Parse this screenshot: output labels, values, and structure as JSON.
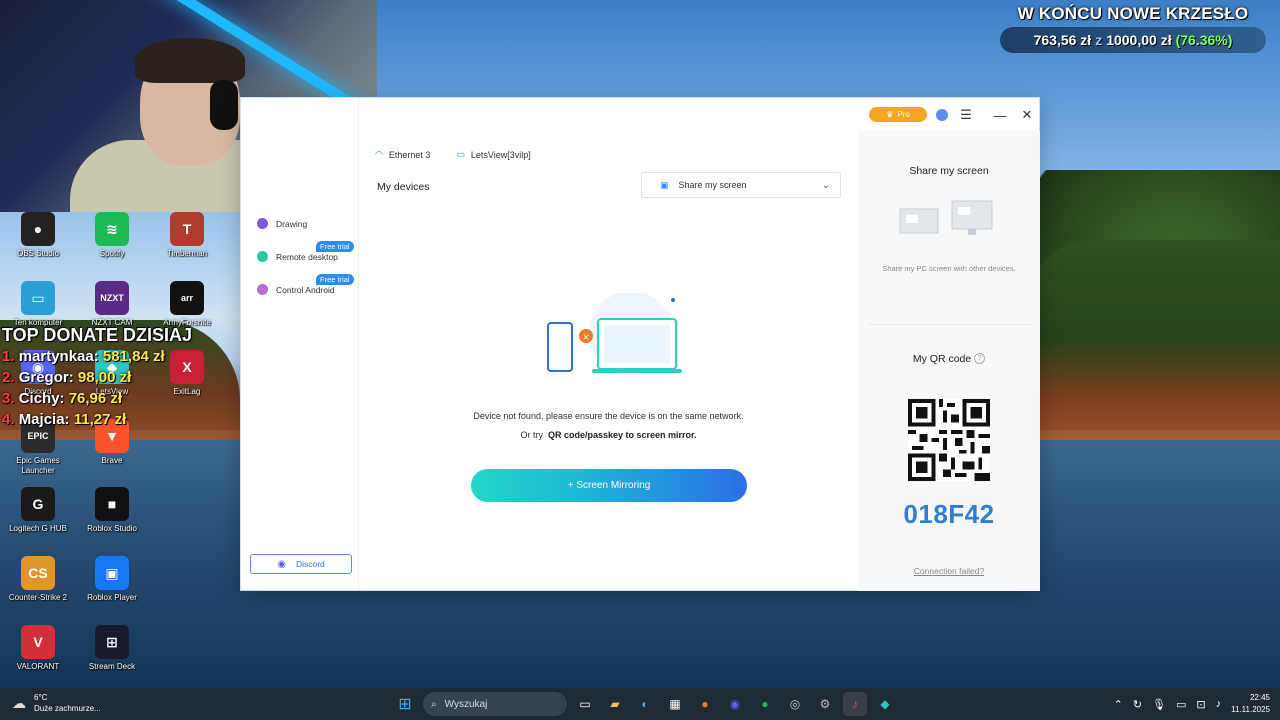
{
  "stream_overlay": {
    "goal_title": "W KOŃCU NOWE KRZESŁO",
    "goal_current": "763,56 zł",
    "goal_sep": "z",
    "goal_target": "1000,00 zł",
    "goal_percent": "(76.36%)",
    "top_donate_title": "TOP DONATE DZISIAJ",
    "top_donate": [
      {
        "rank": "1.",
        "name": "martynkaa:",
        "amount": "581,84 zł"
      },
      {
        "rank": "2.",
        "name": "Gregor:",
        "amount": "98,00 zł"
      },
      {
        "rank": "3.",
        "name": "Cichy:",
        "amount": "76,96 zł"
      },
      {
        "rank": "4.",
        "name": "Majcia:",
        "amount": "11,27 zł"
      }
    ]
  },
  "desktop_icons": [
    {
      "label": "OBS Studio",
      "color": "#222222",
      "glyph": "●"
    },
    {
      "label": "Spotify",
      "color": "#1db954",
      "glyph": "≋"
    },
    {
      "label": "Timberman",
      "color": "#b33a2e",
      "glyph": "T"
    },
    {
      "label": "Ten komputer",
      "color": "#2a9fd6",
      "glyph": "▭"
    },
    {
      "label": "NZXT CAM",
      "color": "#5b2a86",
      "glyph": "NZXT"
    },
    {
      "label": "ArmyForsnite",
      "color": "#111111",
      "glyph": "arr"
    },
    {
      "label": "Discord",
      "color": "#5865f2",
      "glyph": "◉"
    },
    {
      "label": "LetsView",
      "color": "#2fc5c0",
      "glyph": "◆"
    },
    {
      "label": "ExitLag",
      "color": "#c91f37",
      "glyph": "X"
    },
    {
      "label": "Epic Games Launcher",
      "color": "#2b2b2b",
      "glyph": "EPIC"
    },
    {
      "label": "Brave",
      "color": "#fb542b",
      "glyph": "▼"
    },
    {
      "label": "Logitech G HUB",
      "color": "#1a1a1a",
      "glyph": "G"
    },
    {
      "label": "Roblox Studio",
      "color": "#111111",
      "glyph": "■"
    },
    {
      "label": "Counter-Strike 2",
      "color": "#e0962a",
      "glyph": "CS"
    },
    {
      "label": "Roblox Player",
      "color": "#1877f2",
      "glyph": "▣"
    },
    {
      "label": "VALORANT",
      "color": "#d32f3a",
      "glyph": "V"
    },
    {
      "label": "Stream Deck",
      "color": "#1a1a2e",
      "glyph": "⊞"
    }
  ],
  "app": {
    "pro_label": "Pro",
    "sidebar": [
      {
        "label": "Drawing",
        "color": "#7b5bd6",
        "trial": ""
      },
      {
        "label": "Remote desktop",
        "color": "#2dc7a6",
        "trial": "Free trial"
      },
      {
        "label": "Control Android",
        "color": "#b86ad6",
        "trial": "Free trial"
      }
    ],
    "discord_label": "Discord",
    "tabs": [
      {
        "label": "Ethernet 3",
        "icon": "wifi-icon"
      },
      {
        "label": "LetsView[3vilp]",
        "icon": "monitor-icon"
      }
    ],
    "my_devices": "My devices",
    "share_dropdown": "Share my screen",
    "message_line1": "Device not found, please ensure the device is on the same network.",
    "message_line2_prefix": "Or try",
    "message_line2_link": "QR code/passkey to screen mirror.",
    "mirror_button": "+ Screen Mirroring",
    "right_panel": {
      "share_title": "Share my screen",
      "share_desc": "Share my PC screen with other devices.",
      "qr_title": "My QR code",
      "code": "018F42",
      "connection_failed": "Connection failed?"
    }
  },
  "taskbar": {
    "temperature": "6°C",
    "weather": "Duże zachmurze...",
    "search_placeholder": "Wyszukaj",
    "time": "22:45",
    "date": "11.11.2025"
  }
}
